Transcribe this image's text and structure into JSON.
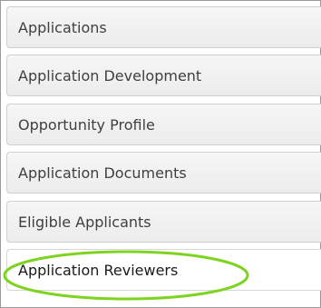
{
  "nav": {
    "items": [
      {
        "label": "Applications"
      },
      {
        "label": "Application Development"
      },
      {
        "label": "Opportunity Profile"
      },
      {
        "label": "Application Documents"
      },
      {
        "label": "Eligible Applicants"
      },
      {
        "label": "Application Reviewers"
      }
    ],
    "active_index": 5
  },
  "colors": {
    "highlight": "#7ed321",
    "tab_bg": "#ececec",
    "tab_border": "#cfcfcf",
    "text": "#3f3f3f"
  }
}
